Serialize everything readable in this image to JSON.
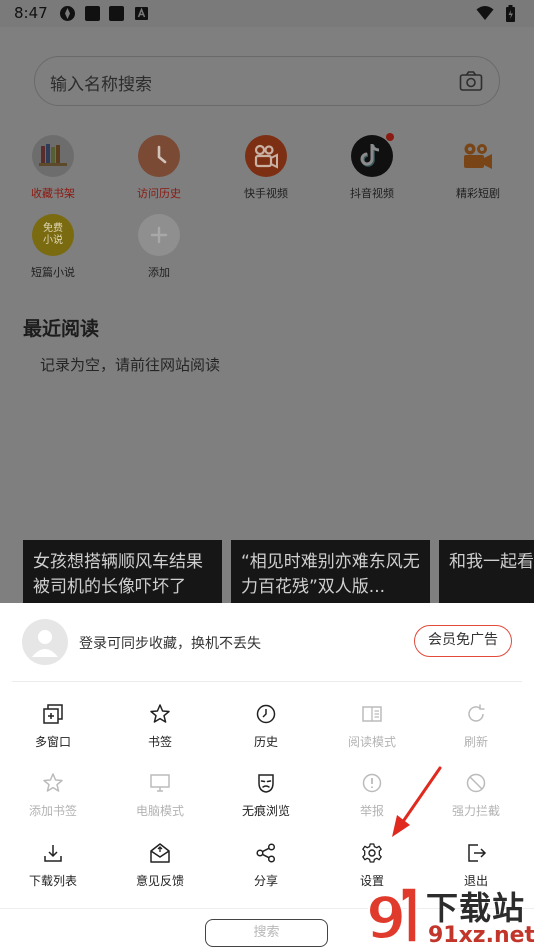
{
  "status_bar": {
    "time": "8:47"
  },
  "search": {
    "placeholder": "输入名称搜索"
  },
  "shortcuts": [
    {
      "label": "收藏书架"
    },
    {
      "label": "访问历史"
    },
    {
      "label": "快手视频"
    },
    {
      "label": "抖音视频"
    },
    {
      "label": "精彩短剧"
    },
    {
      "label": "短篇小说",
      "badge_line1": "免费",
      "badge_line2": "小说"
    },
    {
      "label": "添加"
    }
  ],
  "recent": {
    "title": "最近阅读",
    "empty_text": "记录为空，请前往网站阅读"
  },
  "news": [
    {
      "line1": "女孩想搭辆顺风车结果",
      "line2": "被司机的长像吓坏了"
    },
    {
      "line1": "“相见时难别亦难东风无",
      "line2": "力百花残”双人版..."
    },
    {
      "line1": "和我一起看",
      "line2": ""
    }
  ],
  "menu": {
    "login_text": "登录可同步收藏，换机不丢失",
    "vip_button": "会员免广告",
    "items": [
      {
        "label": "多窗口",
        "icon": "multi-window-icon",
        "enabled": true
      },
      {
        "label": "书签",
        "icon": "star-icon",
        "enabled": true
      },
      {
        "label": "历史",
        "icon": "clock-icon",
        "enabled": true
      },
      {
        "label": "阅读模式",
        "icon": "reader-mode-icon",
        "enabled": false
      },
      {
        "label": "刷新",
        "icon": "refresh-icon",
        "enabled": false
      },
      {
        "label": "添加书签",
        "icon": "star-outline-icon",
        "enabled": false
      },
      {
        "label": "电脑模式",
        "icon": "desktop-icon",
        "enabled": false
      },
      {
        "label": "无痕浏览",
        "icon": "incognito-mask-icon",
        "enabled": true
      },
      {
        "label": "举报",
        "icon": "report-icon",
        "enabled": false
      },
      {
        "label": "强力拦截",
        "icon": "block-icon",
        "enabled": false
      },
      {
        "label": "下载列表",
        "icon": "download-icon",
        "enabled": true
      },
      {
        "label": "意见反馈",
        "icon": "feedback-icon",
        "enabled": true
      },
      {
        "label": "分享",
        "icon": "share-icon",
        "enabled": true
      },
      {
        "label": "设置",
        "icon": "gear-icon",
        "enabled": true
      },
      {
        "label": "退出",
        "icon": "exit-icon",
        "enabled": true
      }
    ],
    "search_button": "搜索"
  },
  "watermark": {
    "title": "下载站",
    "url": "91xz.net"
  },
  "colors": {
    "accent_red": "#e24a3b",
    "overlay_gray": "#7f7f7f"
  }
}
